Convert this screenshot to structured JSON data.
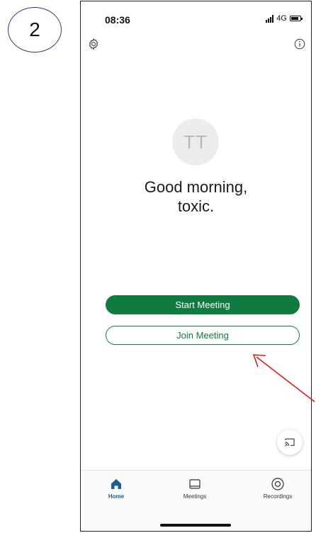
{
  "step": {
    "number": "2"
  },
  "status_bar": {
    "time": "08:36",
    "network": "4G"
  },
  "profile": {
    "initials": "TT"
  },
  "greeting": {
    "line1": "Good morning,",
    "line2": "toxic."
  },
  "actions": {
    "start_label": "Start Meeting",
    "join_label": "Join Meeting"
  },
  "tabs": [
    {
      "label": "Home",
      "icon": "home-icon",
      "active": true
    },
    {
      "label": "Meetings",
      "icon": "meetings-icon",
      "active": false
    },
    {
      "label": "Recordings",
      "icon": "recordings-icon",
      "active": false
    }
  ],
  "colors": {
    "brand_green": "#117a3e",
    "active_tab": "#1f5e8a",
    "annotation_arrow": "#e21b1b"
  }
}
